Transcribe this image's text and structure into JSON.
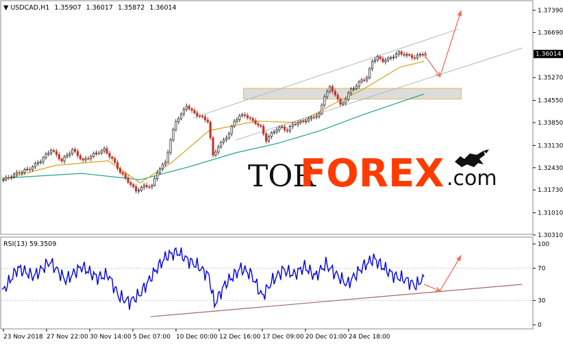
{
  "chart_data": [
    {
      "type": "candlestick",
      "symbol_header": "USDCAD,H1",
      "ohlc": {
        "open": "1.35907",
        "high": "1.36017",
        "low": "1.35872",
        "close": "1.36014"
      },
      "current_price_label": "1.36014",
      "ylim": [
        1.3031,
        1.3739
      ],
      "y_ticks": [
        "1.37390",
        "1.36690",
        "1.35270",
        "1.34550",
        "1.33850",
        "1.33130",
        "1.32430",
        "1.31730",
        "1.31010",
        "1.30310"
      ],
      "x_ticks": [
        "23 Nov 2018",
        "27 Nov 22:00",
        "30 Nov 14:00",
        "5 Dec 07:00",
        "10 Dec 00:00",
        "12 Dec 16:00",
        "17 Dec 09:00",
        "20 Dec 01:00",
        "24 Dec 18:00"
      ],
      "close_path": [
        [
          0,
          1.3205
        ],
        [
          5,
          1.3225
        ],
        [
          10,
          1.324
        ],
        [
          14,
          1.3265
        ],
        [
          18,
          1.33
        ],
        [
          22,
          1.3265
        ],
        [
          26,
          1.33
        ],
        [
          30,
          1.3265
        ],
        [
          34,
          1.3285
        ],
        [
          38,
          1.33
        ],
        [
          41,
          1.327
        ],
        [
          44,
          1.323
        ],
        [
          47,
          1.32
        ],
        [
          50,
          1.317
        ],
        [
          53,
          1.3185
        ],
        [
          56,
          1.3185
        ],
        [
          58,
          1.323
        ],
        [
          61,
          1.326
        ],
        [
          63,
          1.333
        ],
        [
          65,
          1.339
        ],
        [
          67,
          1.341
        ],
        [
          69,
          1.344
        ],
        [
          71,
          1.342
        ],
        [
          73,
          1.341
        ],
        [
          75,
          1.34
        ],
        [
          77,
          1.339
        ],
        [
          79,
          1.328
        ],
        [
          81,
          1.331
        ],
        [
          83,
          1.333
        ],
        [
          85,
          1.335
        ],
        [
          87,
          1.339
        ],
        [
          89,
          1.3405
        ],
        [
          91,
          1.341
        ],
        [
          93,
          1.3395
        ],
        [
          95,
          1.3385
        ],
        [
          97,
          1.337
        ],
        [
          99,
          1.333
        ],
        [
          101,
          1.335
        ],
        [
          103,
          1.3365
        ],
        [
          105,
          1.337
        ],
        [
          107,
          1.336
        ],
        [
          109,
          1.338
        ],
        [
          111,
          1.3385
        ],
        [
          113,
          1.339
        ],
        [
          115,
          1.3395
        ],
        [
          117,
          1.3405
        ],
        [
          119,
          1.341
        ],
        [
          121,
          1.347
        ],
        [
          123,
          1.3495
        ],
        [
          125,
          1.3475
        ],
        [
          127,
          1.344
        ],
        [
          129,
          1.346
        ],
        [
          131,
          1.349
        ],
        [
          133,
          1.35
        ],
        [
          135,
          1.352
        ],
        [
          137,
          1.3525
        ],
        [
          139,
          1.358
        ],
        [
          141,
          1.359
        ],
        [
          143,
          1.358
        ],
        [
          145,
          1.3585
        ],
        [
          147,
          1.3595
        ],
        [
          149,
          1.3605
        ],
        [
          151,
          1.36
        ],
        [
          153,
          1.3595
        ],
        [
          155,
          1.359
        ],
        [
          157,
          1.36
        ],
        [
          159,
          1.3601
        ]
      ],
      "ma_fast": [
        [
          0,
          1.3205
        ],
        [
          20,
          1.325
        ],
        [
          40,
          1.3265
        ],
        [
          52,
          1.3195
        ],
        [
          64,
          1.326
        ],
        [
          78,
          1.336
        ],
        [
          96,
          1.339
        ],
        [
          112,
          1.3385
        ],
        [
          124,
          1.344
        ],
        [
          136,
          1.349
        ],
        [
          150,
          1.356
        ],
        [
          159,
          1.3578
        ]
      ],
      "ma_slow": [
        [
          0,
          1.321
        ],
        [
          30,
          1.3225
        ],
        [
          52,
          1.3205
        ],
        [
          70,
          1.3245
        ],
        [
          88,
          1.329
        ],
        [
          104,
          1.332
        ],
        [
          120,
          1.336
        ],
        [
          136,
          1.341
        ],
        [
          150,
          1.345
        ],
        [
          159,
          1.3475
        ]
      ],
      "support_zone": [
        1.3459,
        1.3493
      ],
      "channel_upper": [
        [
          72,
          1.34
        ],
        [
          172,
          1.368
        ]
      ],
      "channel_lower": [
        [
          88,
          1.333
        ],
        [
          196,
          1.362
        ]
      ],
      "forecast_arrow": [
        [
          159,
          1.36
        ],
        [
          165,
          1.353
        ],
        [
          173,
          1.3739
        ]
      ],
      "colors": {
        "bull": "#2f2f2f",
        "bear": "#c0392b",
        "ma_fast": "#d4a017",
        "ma_slow": "#1f9e8f",
        "zone_fill": "#dcdcdc",
        "zone_border": "#e8b84a",
        "channel": "#a8b8cc",
        "arrow": "#f26b5b"
      }
    },
    {
      "type": "line",
      "indicator_header": "RSI(13) 59.3509",
      "ylim": [
        0,
        100
      ],
      "y_ticks": [
        "100",
        "70",
        "30",
        "0"
      ],
      "levels": [
        70,
        30
      ],
      "rsi_path": [
        [
          0,
          40
        ],
        [
          6,
          70
        ],
        [
          12,
          60
        ],
        [
          18,
          78
        ],
        [
          24,
          55
        ],
        [
          30,
          72
        ],
        [
          36,
          58
        ],
        [
          40,
          62
        ],
        [
          44,
          35
        ],
        [
          48,
          28
        ],
        [
          52,
          38
        ],
        [
          58,
          68
        ],
        [
          62,
          85
        ],
        [
          66,
          90
        ],
        [
          70,
          80
        ],
        [
          74,
          72
        ],
        [
          78,
          60
        ],
        [
          80,
          25
        ],
        [
          84,
          50
        ],
        [
          90,
          70
        ],
        [
          94,
          62
        ],
        [
          98,
          35
        ],
        [
          102,
          55
        ],
        [
          106,
          68
        ],
        [
          110,
          62
        ],
        [
          114,
          72
        ],
        [
          118,
          60
        ],
        [
          122,
          75
        ],
        [
          126,
          62
        ],
        [
          130,
          50
        ],
        [
          136,
          72
        ],
        [
          140,
          82
        ],
        [
          144,
          70
        ],
        [
          148,
          60
        ],
        [
          152,
          56
        ],
        [
          156,
          48
        ],
        [
          159,
          59.35
        ]
      ],
      "trendline": [
        [
          56,
          10
        ],
        [
          196,
          50
        ]
      ],
      "forecast_arrow": [
        [
          159,
          50
        ],
        [
          165,
          42
        ],
        [
          173,
          86
        ]
      ],
      "colors": {
        "line": "#0000dd",
        "trendline": "#a06a6a",
        "arrow": "#f26b5b"
      }
    }
  ],
  "watermark": {
    "part1": "TOR",
    "part2": "FOREX",
    "part3": ".com",
    "bull_icon": "bull-icon"
  }
}
